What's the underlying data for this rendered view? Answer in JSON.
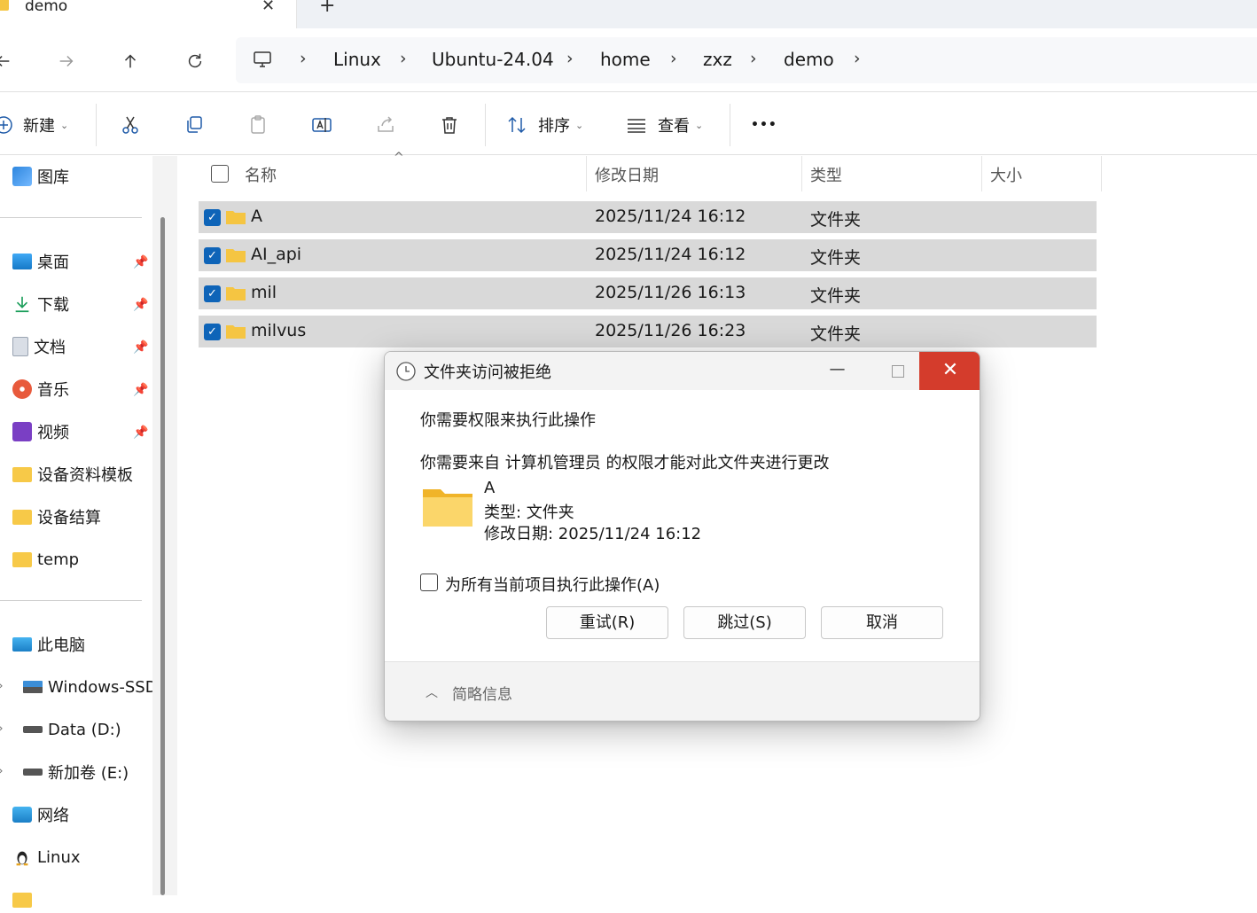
{
  "tab": {
    "title": "demo",
    "close": "✕",
    "new": "+"
  },
  "breadcrumb": {
    "items": [
      "Linux",
      "Ubuntu-24.04",
      "home",
      "zxz",
      "demo"
    ],
    "separator": "›"
  },
  "toolbar": {
    "new_label": "新建",
    "sort_label": "排序",
    "view_label": "查看",
    "more": "•••"
  },
  "sidebar": {
    "gallery": "图库",
    "quick": [
      {
        "label": "桌面",
        "icon": "desktop-icon",
        "pinned": true
      },
      {
        "label": "下载",
        "icon": "download-icon",
        "pinned": true
      },
      {
        "label": "文档",
        "icon": "documents-icon",
        "pinned": true
      },
      {
        "label": "音乐",
        "icon": "music-icon",
        "pinned": true
      },
      {
        "label": "视频",
        "icon": "videos-icon",
        "pinned": true
      },
      {
        "label": "设备资料模板",
        "icon": "folder-icon",
        "pinned": false
      },
      {
        "label": "设备结算",
        "icon": "folder-icon",
        "pinned": false
      },
      {
        "label": "temp",
        "icon": "folder-icon",
        "pinned": false
      }
    ],
    "this_pc": "此电脑",
    "drives": [
      "Windows-SSD",
      "Data (D:)",
      "新加卷 (E:)"
    ],
    "network": "网络",
    "linux": "Linux"
  },
  "columns": {
    "name": "名称",
    "modified": "修改日期",
    "type": "类型",
    "size": "大小"
  },
  "files": [
    {
      "name": "A",
      "modified": "2025/11/24 16:12",
      "type": "文件夹",
      "selected": true
    },
    {
      "name": "AI_api",
      "modified": "2025/11/24 16:12",
      "type": "文件夹",
      "selected": true
    },
    {
      "name": "mil",
      "modified": "2025/11/26 16:13",
      "type": "文件夹",
      "selected": true
    },
    {
      "name": "milvus",
      "modified": "2025/11/26 16:23",
      "type": "文件夹",
      "selected": true
    }
  ],
  "dialog": {
    "title": "文件夹访问被拒绝",
    "heading": "你需要权限来执行此操作",
    "message": "你需要来自 计算机管理员 的权限才能对此文件夹进行更改",
    "file_name": "A",
    "file_type": "类型: 文件夹",
    "file_date": "修改日期: 2025/11/24 16:12",
    "apply_all": "为所有当前项目执行此操作(A)",
    "retry": "重试(R)",
    "skip": "跳过(S)",
    "cancel": "取消",
    "less_info": "简略信息",
    "close_glyph": "✕",
    "min_glyph": "—"
  },
  "colors": {
    "selection": "#d9d9d9",
    "checkbox": "#0e64b8",
    "close_red": "#d43c2c",
    "folder": "#f5c542"
  }
}
